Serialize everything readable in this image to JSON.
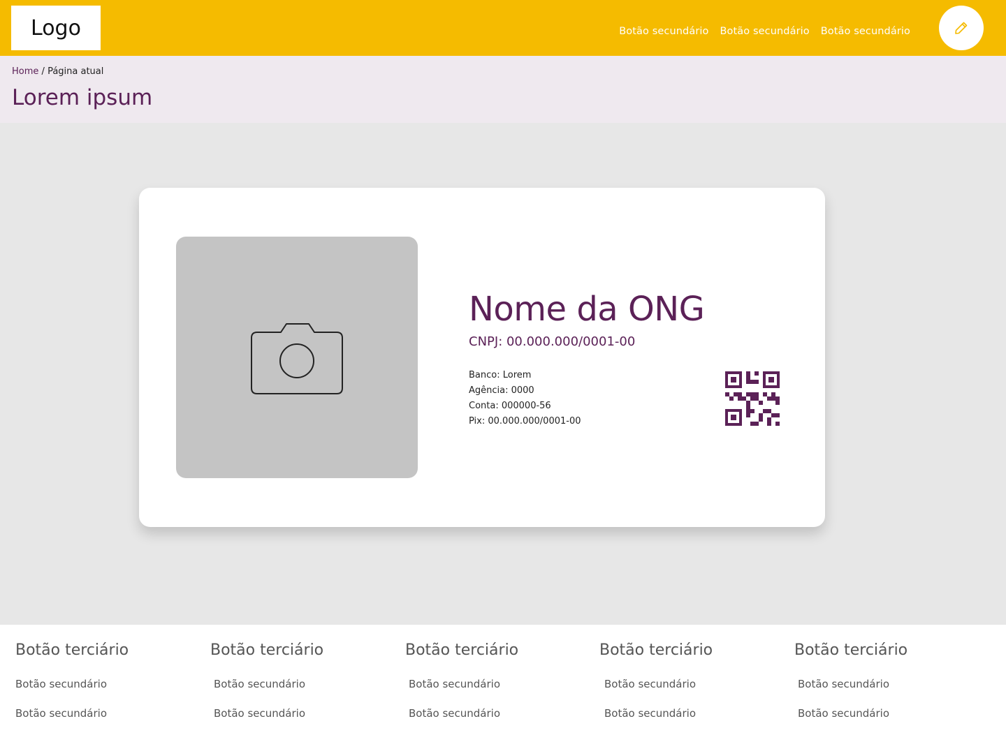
{
  "header": {
    "logo": "Logo",
    "nav": [
      "Botão secundário",
      "Botão secundário",
      "Botão secundário"
    ],
    "edit_icon": "pencil-icon"
  },
  "breadcrumb": {
    "home": "Home",
    "separator": "/",
    "current": "Página atual"
  },
  "page_title": "Lorem ipsum",
  "card": {
    "photo_icon": "camera-icon",
    "name": "Nome da ONG",
    "cnpj": "CNPJ: 00.000.000/0001-00",
    "bank": [
      "Banco: Lorem",
      "Agência: 0000",
      "Conta: 000000-56",
      "Pix: 00.000.000/0001-00"
    ],
    "qr_icon": "qr-code-icon"
  },
  "footer": {
    "columns": [
      {
        "title": "Botão terciário",
        "links": [
          "Botão secundário",
          "Botão secundário"
        ]
      },
      {
        "title": "Botão terciário",
        "links": [
          "Botão secundário",
          "Botão secundário"
        ]
      },
      {
        "title": "Botão terciário",
        "links": [
          "Botão secundário",
          "Botão secundário"
        ]
      },
      {
        "title": "Botão terciário",
        "links": [
          "Botão secundário",
          "Botão secundário"
        ]
      },
      {
        "title": "Botão terciário",
        "links": [
          "Botão secundário",
          "Botão secundário"
        ]
      }
    ]
  },
  "colors": {
    "accent": "#f5bb00",
    "brand": "#5b2157",
    "title_bg": "#efe9ef",
    "page_bg": "#e7e7e7"
  }
}
